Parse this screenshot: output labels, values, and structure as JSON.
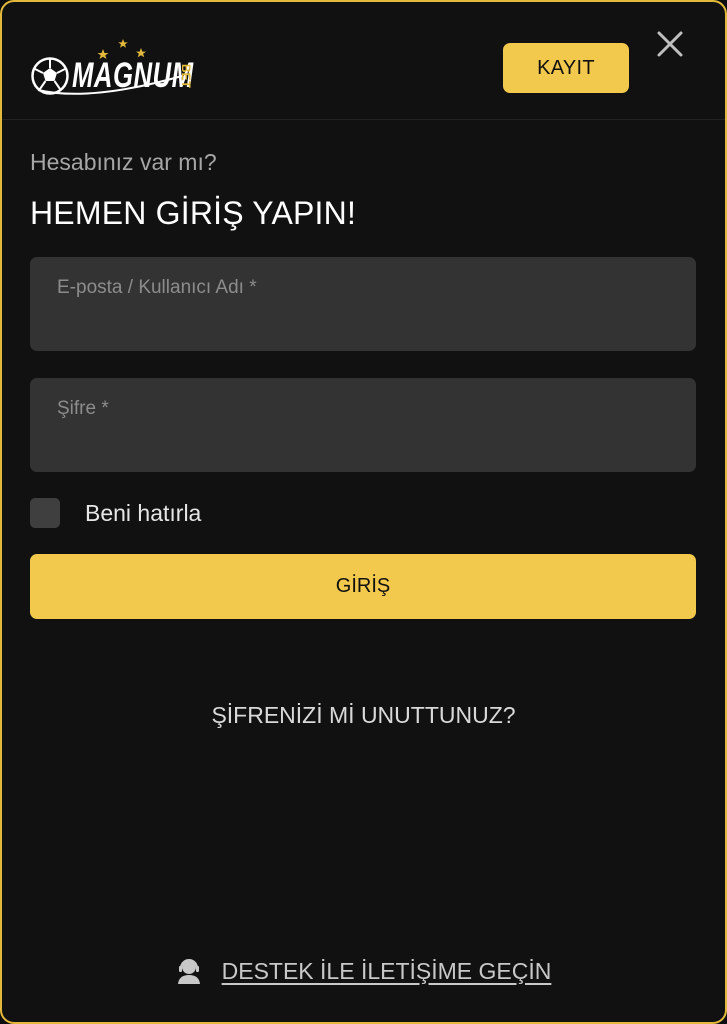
{
  "header": {
    "logo_text": "MAGNUM",
    "logo_subtext": "BET",
    "register_label": "KAYIT",
    "close_icon": "close-icon",
    "logo_icon": "soccer-ball-icon"
  },
  "login": {
    "subtitle": "Hesabınız var mı?",
    "title": "HEMEN GİRİŞ YAPIN!",
    "email_placeholder": "E-posta / Kullanıcı Adı *",
    "email_value": "",
    "password_placeholder": "Şifre *",
    "password_value": "",
    "remember_label": "Beni hatırla",
    "remember_checked": false,
    "submit_label": "GİRİŞ",
    "forgot_label": "ŞİFRENİZİ Mİ UNUTTUNUZ?"
  },
  "support": {
    "label": "DESTEK İLE İLETİŞİME GEÇİN",
    "icon": "support-agent-icon"
  },
  "colors": {
    "accent": "#f2c94c",
    "border": "#e2b93b",
    "background": "#111111",
    "field": "#333333"
  }
}
